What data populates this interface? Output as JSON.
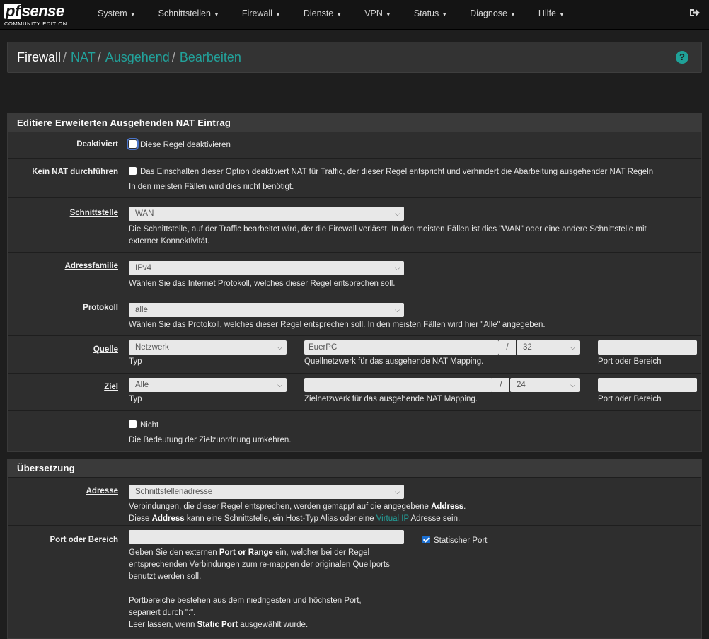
{
  "brand": {
    "logo_pf": "pf",
    "logo_sense": "sense",
    "edition": "COMMUNITY EDITION"
  },
  "nav": [
    {
      "label": "System"
    },
    {
      "label": "Schnittstellen"
    },
    {
      "label": "Firewall"
    },
    {
      "label": "Dienste"
    },
    {
      "label": "VPN"
    },
    {
      "label": "Status"
    },
    {
      "label": "Diagnose"
    },
    {
      "label": "Hilfe"
    }
  ],
  "breadcrumb": {
    "first": "Firewall",
    "items": [
      "NAT",
      "Ausgehend",
      "Bearbeiten"
    ],
    "sep": "/",
    "help_glyph": "?"
  },
  "panel1": {
    "title": "Editiere Erweiterten Ausgehenden NAT Eintrag",
    "disabled": {
      "label": "Deaktiviert",
      "text": "Diese Regel deaktivieren"
    },
    "nonat": {
      "label": "Kein NAT durchführen",
      "text": "Das Einschalten dieser Option deaktiviert NAT für Traffic, der dieser Regel entspricht und verhindert die Abarbeitung ausgehender NAT Regeln",
      "help": "In den meisten Fällen wird dies nicht benötigt."
    },
    "interface": {
      "label": "Schnittstelle",
      "value": "WAN",
      "help1": "Die Schnittstelle, auf der Traffic bearbeitet wird, der die Firewall verlässt. In den meisten Fällen ist dies \"WAN\" oder eine andere Schnittstelle mit",
      "help2": "externer Konnektivität."
    },
    "family": {
      "label": "Adressfamilie",
      "value": "IPv4",
      "help": "Wählen Sie das Internet Protokoll, welches dieser Regel entsprechen soll."
    },
    "protocol": {
      "label": "Protokoll",
      "value": "alle",
      "help": "Wählen Sie das Protokoll, welches dieser Regel entsprechen soll. In den meisten Fällen wird hier \"Alle\" angegeben."
    },
    "source": {
      "label": "Quelle",
      "type": "Netzwerk",
      "type_help": "Typ",
      "network": "EuerPC",
      "mask": "32",
      "network_help": "Quellnetzwerk für das ausgehende NAT Mapping.",
      "port_help": "Port oder Bereich",
      "slash": "/"
    },
    "dest": {
      "label": "Ziel",
      "type": "Alle",
      "type_help": "Typ",
      "network": "",
      "mask": "24",
      "network_help": "Zielnetzwerk für das ausgehende NAT Mapping.",
      "port_help": "Port oder Bereich",
      "slash": "/"
    },
    "not": {
      "text": "Nicht",
      "help": "Die Bedeutung der Zielzuordnung umkehren."
    }
  },
  "panel2": {
    "title": "Übersetzung",
    "address": {
      "label": "Adresse",
      "value": "Schnittstellenadresse",
      "h1a": "Verbindungen, die dieser Regel entsprechen, werden gemappt auf die angegebene ",
      "h1b": "Address",
      "h1c": ".",
      "h2a": "Diese ",
      "h2b": "Address",
      "h2c": " kann eine Schnittstelle, ein Host-Typ Alias oder eine ",
      "h2link": "Virtual IP",
      "h2d": " Adresse sein."
    },
    "port": {
      "label": "Port oder Bereich",
      "value": "",
      "static_label": "Statischer Port",
      "h1a": "Geben Sie den externen ",
      "h1b": "Port or Range",
      "h1c": " ein, welcher bei der Regel",
      "h2": "entsprechenden Verbindungen zum re-mappen der originalen Quellports",
      "h3": "benutzt werden soll.",
      "h4": "Portbereiche bestehen aus dem niedrigesten und höchsten Port,",
      "h5": "separiert durch \":\".",
      "h6a": "Leer lassen, wenn ",
      "h6b": "Static Port",
      "h6c": " ausgewählt wurde."
    }
  }
}
